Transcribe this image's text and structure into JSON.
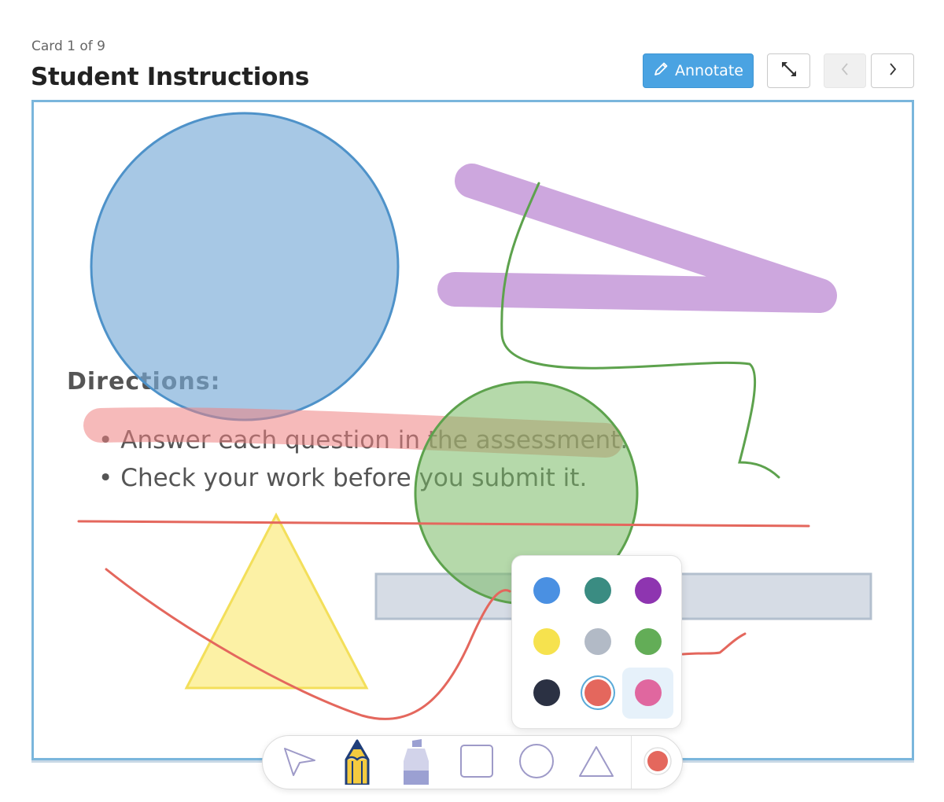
{
  "header": {
    "card_counter": "Card 1 of 9",
    "title": "Student Instructions",
    "annotate_label": "Annotate",
    "annotate_icon": "pencil-icon",
    "expand_icon": "expand-arrows-icon",
    "prev_icon": "chevron-left-icon",
    "next_icon": "chevron-right-icon"
  },
  "content": {
    "directions_heading": "Directions:",
    "items": [
      "Answer each question in the assessment.",
      "Check your work before you submit it."
    ]
  },
  "palette": {
    "colors": [
      "#4a90e2",
      "#3a8c82",
      "#8e35b0",
      "#f6e24e",
      "#b2bac6",
      "#63ad57",
      "#2b3143",
      "#e4675d",
      "#e0679f"
    ],
    "selected": "#e4675d"
  },
  "toolbar": {
    "tools": [
      "select-arrow-icon",
      "pencil-icon",
      "highlighter-icon",
      "square-icon",
      "circle-icon",
      "triangle-icon"
    ],
    "active_tool": "pencil-icon",
    "current_color": "#e4675d"
  }
}
